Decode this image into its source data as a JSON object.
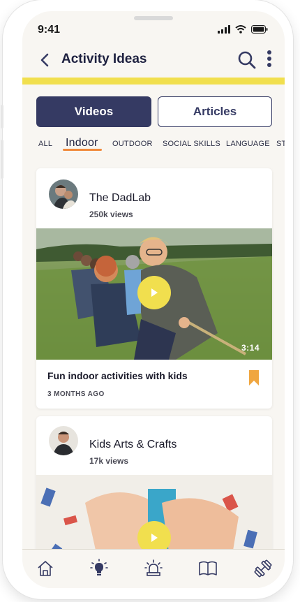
{
  "status": {
    "time": "9:41"
  },
  "header": {
    "title": "Activity Ideas"
  },
  "tabs": {
    "videos": "Videos",
    "articles": "Articles"
  },
  "categories": {
    "all": "ALL",
    "indoor": "Indoor",
    "outdoor": "OUTDOOR",
    "social": "SOCIAL SKILLS",
    "language": "LANGUAGE",
    "more": "ST"
  },
  "videos": [
    {
      "channel": "The DadLab",
      "views": "250k views",
      "duration": "3:14",
      "title": "Fun indoor activities with kids",
      "age": "3 MONTHS AGO",
      "bookmarked": true
    },
    {
      "channel": "Kids Arts & Crafts",
      "views": "17k views"
    }
  ],
  "nav": [
    "home-icon",
    "lightbulb-icon",
    "alarm-icon",
    "book-icon",
    "dumbbell-icon"
  ],
  "colors": {
    "primary": "#353a63",
    "accent_yellow": "#f1df4e",
    "accent_orange": "#f08a3c",
    "bookmark": "#f0a640",
    "background": "#f8f6f2"
  }
}
